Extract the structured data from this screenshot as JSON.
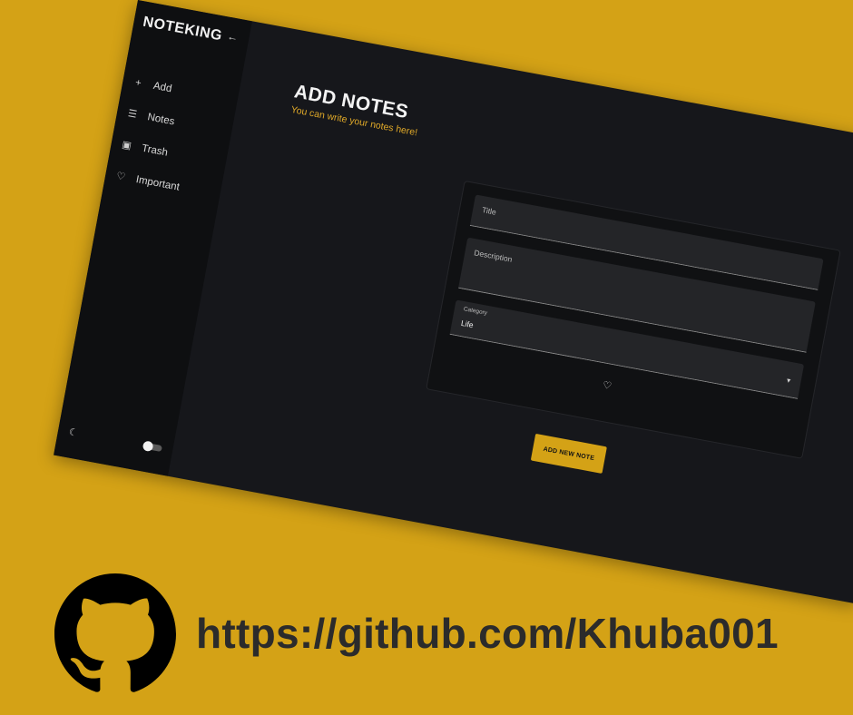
{
  "app": {
    "brand": "NOTEKING",
    "collapse_icon": "arrow-left-icon"
  },
  "sidebar": {
    "items": [
      {
        "label": "Add",
        "icon": "plus-icon"
      },
      {
        "label": "Notes",
        "icon": "list-icon"
      },
      {
        "label": "Trash",
        "icon": "trash-icon"
      },
      {
        "label": "Important",
        "icon": "heart-icon"
      }
    ],
    "theme_icon": "moon-icon",
    "toggle_state": "off"
  },
  "main": {
    "title": "ADD NOTES",
    "subtitle": "You can write your notes here!"
  },
  "form": {
    "title_placeholder": "Title",
    "description_placeholder": "Description",
    "category_label": "Category",
    "category_value": "Life",
    "submit_label": "ADD NEW NOTE"
  },
  "footer": {
    "link": "https://github.com/Khuba001",
    "icon": "github-icon"
  },
  "colors": {
    "background": "#d4a216",
    "accent": "#d4a216",
    "panel": "#16171b",
    "sidebar": "#0e0f11",
    "subtitle": "#e0a928"
  }
}
